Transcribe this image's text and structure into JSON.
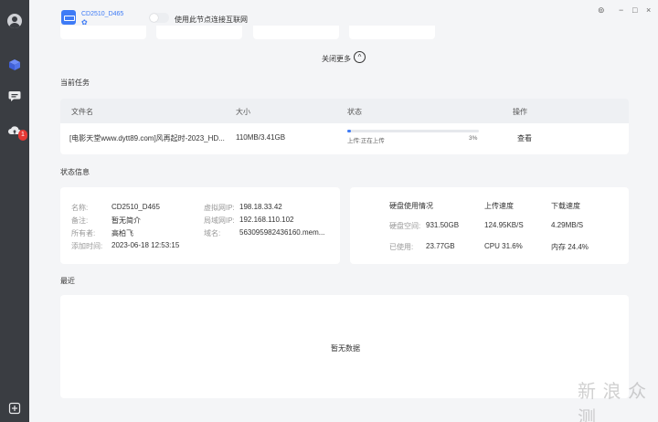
{
  "device": {
    "name": "CD2510_D465",
    "sub_icon": "✿"
  },
  "toggle": {
    "label": "使用此节点连接互联网"
  },
  "collapse": {
    "label": "关闭更多",
    "icon": "chevron-up-icon",
    "glyph": "^"
  },
  "window": {
    "settings": "⊚",
    "minimize": "−",
    "maximize": "□",
    "close": "×"
  },
  "badge": {
    "count": "1"
  },
  "current_task": {
    "title": "当前任务",
    "columns": [
      "文件名",
      "大小",
      "状态",
      "操作"
    ],
    "rows": [
      {
        "filename": "[电影天堂www.dytt89.com]风再起时-2023_HD...",
        "size": "110MB/3.41GB",
        "status": "上传:正在上传",
        "progress": 3,
        "percent": "3%",
        "action": "查看"
      }
    ]
  },
  "status_info": {
    "title": "状态信息",
    "left": [
      {
        "label": "名称:",
        "value": "CD2510_D465"
      },
      {
        "label": "备注:",
        "value": "暂无简介"
      },
      {
        "label": "所有者:",
        "value": "高柏飞"
      },
      {
        "label": "添加时间:",
        "value": "2023-06-18 12:53:15"
      }
    ],
    "mid": [
      {
        "label": "虚拟网IP:",
        "value": "198.18.33.42"
      },
      {
        "label": "局域网IP:",
        "value": "192.168.110.102"
      },
      {
        "label": "域名:",
        "value": "563095982436160.mem..."
      }
    ],
    "disk": {
      "headers": [
        "硬盘使用情况",
        "上传速度",
        "下载速度"
      ],
      "space_label": "硬盘空间:",
      "space_value": "931.50GB",
      "upload_speed": "124.95KB/S",
      "download_speed": "4.29MB/S",
      "used_label": "已使用:",
      "used_value": "23.77GB",
      "cpu": "CPU 31.6%",
      "memory": "内存 24.4%"
    }
  },
  "recent": {
    "title": "最近",
    "empty": "暂无数据"
  },
  "watermark": "新 浪 众 测",
  "colors": {
    "accent": "#3e7bf6",
    "sidebar": "#3a3d42",
    "badge": "#e53935"
  }
}
